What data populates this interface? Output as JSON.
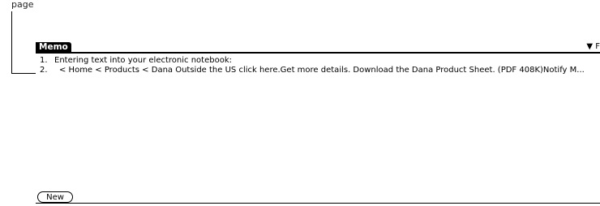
{
  "callout": {
    "text": "page"
  },
  "memo": {
    "title": "Memo",
    "category": "▼ F",
    "items": [
      {
        "number": "1.",
        "text": "Entering text into your electronic notebook:"
      },
      {
        "number": "2.",
        "text": "< Home  < Products  < Dana  Outside the US click here.Get more details. Download the Dana Product Sheet. (PDF 408K)Notify M..."
      }
    ],
    "new_label": "New"
  }
}
